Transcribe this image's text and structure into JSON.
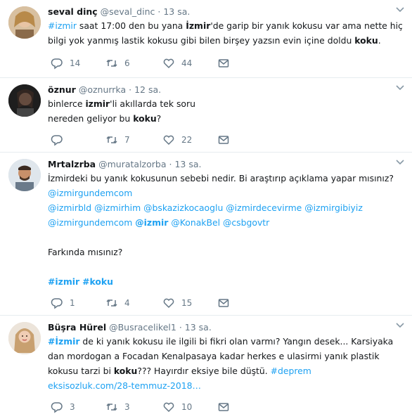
{
  "tweets": [
    {
      "name": "seval dinç",
      "handle": "@seval_dinc",
      "dot": "·",
      "time": "13 sa.",
      "lines": [
        [
          {
            "t": "#izmir",
            "c": "hashtag"
          },
          {
            "t": " saat 17:00 den bu yana ",
            "c": ""
          },
          {
            "t": "İzmir",
            "c": "b"
          },
          {
            "t": "'de garip bir yanık kokusu var ama nette hiç",
            "c": ""
          }
        ],
        [
          {
            "t": "bilgi yok yanmış lastik kokusu gibi bilen birşey yazsın evin içine doldu ",
            "c": ""
          },
          {
            "t": "koku",
            "c": "b"
          },
          {
            "t": ".",
            "c": ""
          }
        ]
      ],
      "replies": "14",
      "retweets": "6",
      "likes": "44"
    },
    {
      "name": "öznur",
      "handle": "@oznurrka",
      "dot": "·",
      "time": "12 sa.",
      "lines": [
        [
          {
            "t": "binlerce ",
            "c": ""
          },
          {
            "t": "izmir",
            "c": "b"
          },
          {
            "t": "'li akıllarda tek soru",
            "c": ""
          }
        ],
        [
          {
            "t": "nereden geliyor bu ",
            "c": ""
          },
          {
            "t": "koku",
            "c": "b"
          },
          {
            "t": "?",
            "c": ""
          }
        ]
      ],
      "replies": "",
      "retweets": "7",
      "likes": "22"
    },
    {
      "name": "Mrtalzrba",
      "handle": "@muratalzorba",
      "dot": "·",
      "time": "13 sa.",
      "lines": [
        [
          {
            "t": "İzmirdeki bu yanık kokusunun sebebi nedir. Bi araştırıp açıklama yapar mısınız?",
            "c": ""
          }
        ],
        [
          {
            "t": "@izmirgundemcom",
            "c": "mention"
          }
        ],
        [
          {
            "t": "@izmirbld",
            "c": "mention"
          },
          {
            "t": " ",
            "c": ""
          },
          {
            "t": "@izmirhim",
            "c": "mention"
          },
          {
            "t": " ",
            "c": ""
          },
          {
            "t": "@bskazizkocaoglu",
            "c": "mention"
          },
          {
            "t": " ",
            "c": ""
          },
          {
            "t": "@izmirdecevirme",
            "c": "mention"
          },
          {
            "t": " ",
            "c": ""
          },
          {
            "t": "@izmirgibiyiz",
            "c": "mention"
          }
        ],
        [
          {
            "t": "@izmirgundemcom",
            "c": "mention"
          },
          {
            "t": " ",
            "c": ""
          },
          {
            "t": "@izmir",
            "c": "mention b"
          },
          {
            "t": " ",
            "c": ""
          },
          {
            "t": "@KonakBel",
            "c": "mention"
          },
          {
            "t": " ",
            "c": ""
          },
          {
            "t": "@csbgovtr",
            "c": "mention"
          }
        ],
        [],
        [
          {
            "t": "Farkında mısınız?",
            "c": ""
          }
        ],
        [],
        [
          {
            "t": "#izmir",
            "c": "hashtag b"
          },
          {
            "t": " ",
            "c": ""
          },
          {
            "t": "#koku",
            "c": "hashtag b"
          }
        ]
      ],
      "replies": "1",
      "retweets": "4",
      "likes": "15"
    },
    {
      "name": "Büşra Hürel",
      "handle": "@Busracelikel1",
      "dot": "·",
      "time": "13 sa.",
      "lines": [
        [
          {
            "t": "#İzmir",
            "c": "hashtag b"
          },
          {
            "t": " de ki yanık kokusu ile ilgili bi fikri olan varmı? Yangın desek... Karsiyaka",
            "c": ""
          }
        ],
        [
          {
            "t": "dan mordogan a Focadan Kenalpasaya kadar herkes e ulasirmi yanık plastik",
            "c": ""
          }
        ],
        [
          {
            "t": "kokusu tarzi bi ",
            "c": ""
          },
          {
            "t": "koku",
            "c": "b"
          },
          {
            "t": "??? Hayırdır eksiye bile düştü. ",
            "c": ""
          },
          {
            "t": "#deprem",
            "c": "hashtag"
          }
        ],
        [
          {
            "t": "eksisozluk.com/28-temmuz-2018…",
            "c": "link"
          }
        ]
      ],
      "replies": "3",
      "retweets": "3",
      "likes": "10"
    }
  ],
  "colors": {
    "accent": "#1da1f2",
    "muted": "#657786",
    "text": "#14171a",
    "divider": "#e6ecf0"
  }
}
